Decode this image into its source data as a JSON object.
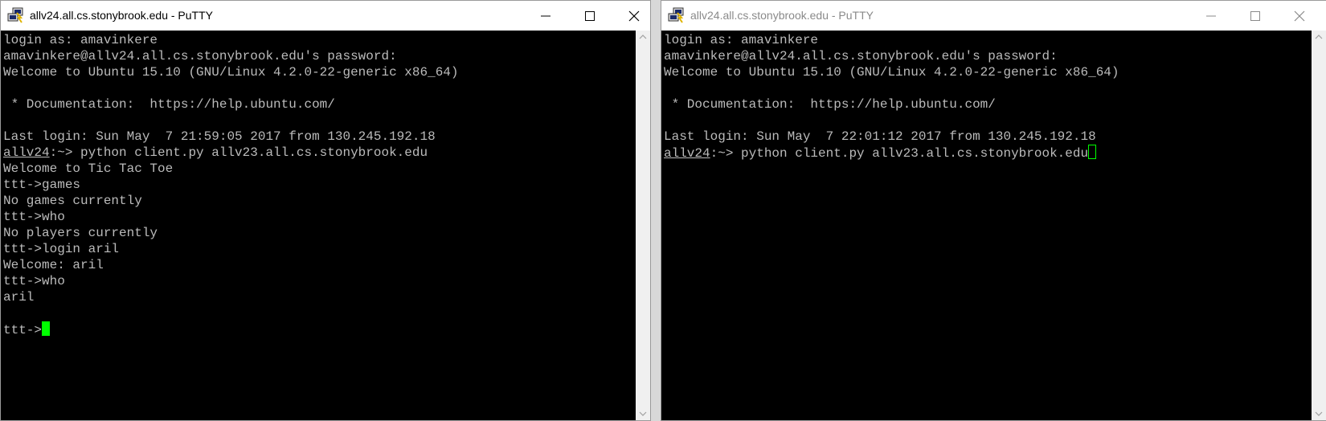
{
  "colors": {
    "terminal_bg": "#000000",
    "terminal_fg": "#bbbbbb",
    "cursor": "#00ff00",
    "titlebar_bg": "#ffffff",
    "inactive_title": "#8a8a8a"
  },
  "left_window": {
    "title": "allv24.all.cs.stonybrook.edu - PuTTY",
    "icon": "putty-icon",
    "lines": [
      "login as: amavinkere",
      "amavinkere@allv24.all.cs.stonybrook.edu's password:",
      "Welcome to Ubuntu 15.10 (GNU/Linux 4.2.0-22-generic x86_64)",
      "",
      " * Documentation:  https://help.ubuntu.com/",
      "",
      "Last login: Sun May  7 21:59:05 2017 from 130.245.192.18"
    ],
    "prompt_host": "allv24",
    "prompt_rest": ":~> python client.py allv23.all.cs.stonybrook.edu",
    "session_lines": [
      "Welcome to Tic Tac Toe",
      "ttt->games",
      "No games currently",
      "ttt->who",
      "No players currently",
      "ttt->login aril",
      "Welcome: aril",
      "ttt->who",
      "aril",
      ""
    ],
    "current_prompt": "ttt->"
  },
  "right_window": {
    "title": "allv24.all.cs.stonybrook.edu - PuTTY",
    "icon": "putty-icon",
    "lines": [
      "login as: amavinkere",
      "amavinkere@allv24.all.cs.stonybrook.edu's password:",
      "Welcome to Ubuntu 15.10 (GNU/Linux 4.2.0-22-generic x86_64)",
      "",
      " * Documentation:  https://help.ubuntu.com/",
      "",
      "Last login: Sun May  7 22:01:12 2017 from 130.245.192.18"
    ],
    "prompt_host": "allv24",
    "prompt_rest": ":~> python client.py allv23.all.cs.stonybrook.edu"
  }
}
